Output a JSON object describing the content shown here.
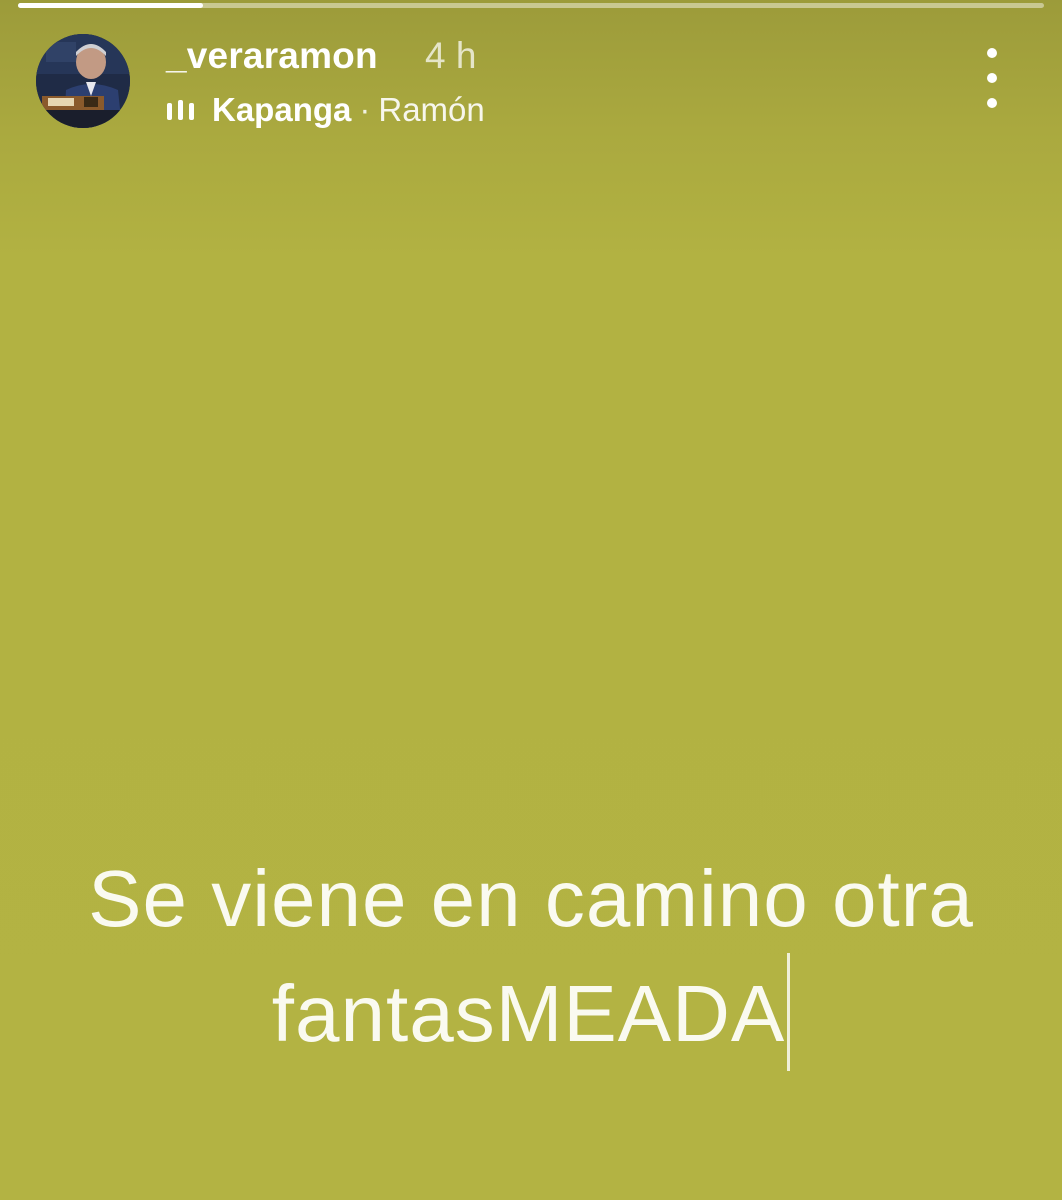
{
  "story": {
    "progress_fraction": 0.18,
    "background_color": "#b3b343"
  },
  "header": {
    "username": "_veraramon",
    "timestamp": "4 h",
    "music": {
      "icon": "audio-bars-icon",
      "song": "Kapanga",
      "separator": "·",
      "artist": "Ramón"
    },
    "more_icon": "more-vertical-icon"
  },
  "caption": {
    "line1": "Se viene en camino otra",
    "line2": "fantasMEADA"
  }
}
